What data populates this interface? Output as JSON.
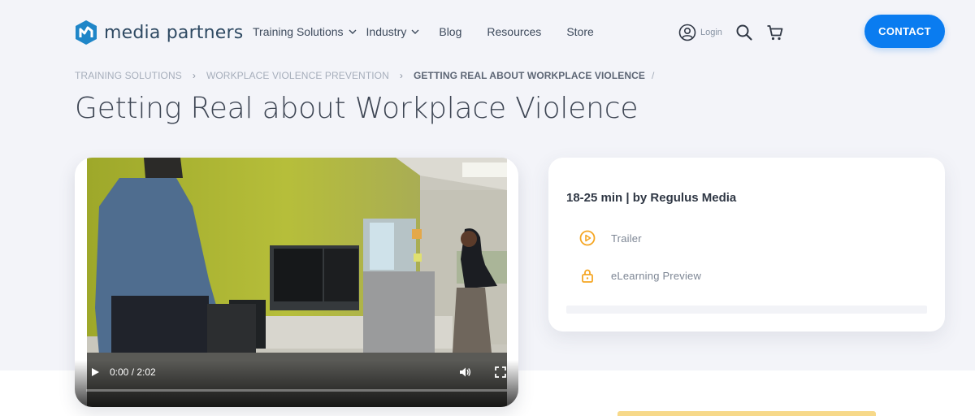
{
  "header": {
    "logo_text": "media partners",
    "nav": [
      {
        "label": "Training Solutions",
        "dropdown": true
      },
      {
        "label": "Industry",
        "dropdown": true
      },
      {
        "label": "Blog",
        "dropdown": false
      },
      {
        "label": "Resources",
        "dropdown": false
      },
      {
        "label": "Store",
        "dropdown": false
      }
    ],
    "login_label": "Login",
    "contact_label": "CONTACT"
  },
  "breadcrumb": {
    "items": [
      "TRAINING SOLUTIONS",
      "WORKPLACE VIOLENCE PREVENTION",
      "GETTING REAL ABOUT WORKPLACE VIOLENCE"
    ],
    "trailing": "/"
  },
  "page": {
    "title": "Getting Real about Workplace Violence"
  },
  "video": {
    "time": "0:00 / 2:02",
    "progress": 0
  },
  "card": {
    "meta": "18-25 min | by Regulus Media",
    "links": [
      {
        "label": "Trailer",
        "icon": "play-circle-icon"
      },
      {
        "label": "eLearning Preview",
        "icon": "lock-icon"
      }
    ]
  },
  "colors": {
    "brand_blue": "#0a7cf0",
    "accent_orange": "#f5a623",
    "logo_blue": "#1f86c8",
    "page_bg": "#f3f4f9"
  }
}
